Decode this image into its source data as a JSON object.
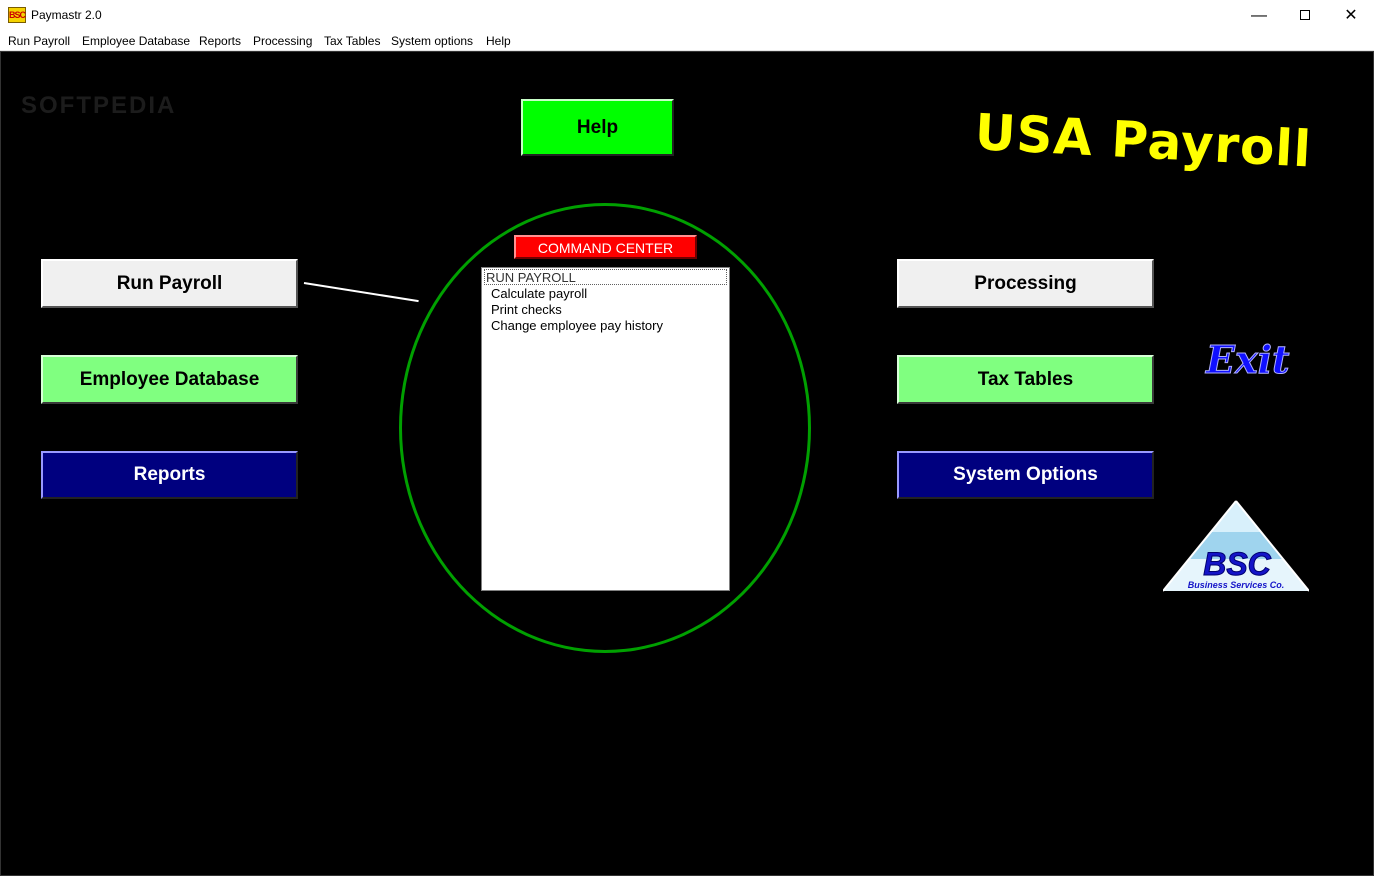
{
  "window": {
    "title": "Paymastr 2.0",
    "icon_label": "BSC",
    "minimize": "—",
    "close": "✕"
  },
  "menu": {
    "items": [
      "Run Payroll",
      "Employee Database",
      "Reports",
      "Processing",
      "Tax Tables",
      "System options",
      "Help"
    ]
  },
  "main": {
    "watermark": "SOFTPEDIA",
    "help_label": "Help",
    "title": "USA Payroll",
    "exit_label": "Exit",
    "left_buttons": [
      "Run Payroll",
      "Employee Database",
      "Reports"
    ],
    "right_buttons": [
      "Processing",
      "Tax Tables",
      "System Options"
    ],
    "command_center": {
      "label": "COMMAND CENTER",
      "header": "RUN PAYROLL",
      "items": [
        "Calculate payroll",
        "Print checks",
        "Change employee pay history"
      ]
    },
    "logo": {
      "letters": "BSC",
      "caption": "Business Services Co."
    }
  },
  "colors": {
    "background": "#000000",
    "help_green": "#00ff00",
    "light_green": "#80ff80",
    "navy": "#00007f",
    "title_yellow": "#ffff00",
    "command_red": "#ff0000",
    "circle_green": "#00a000",
    "exit_blue": "#1010ff"
  }
}
